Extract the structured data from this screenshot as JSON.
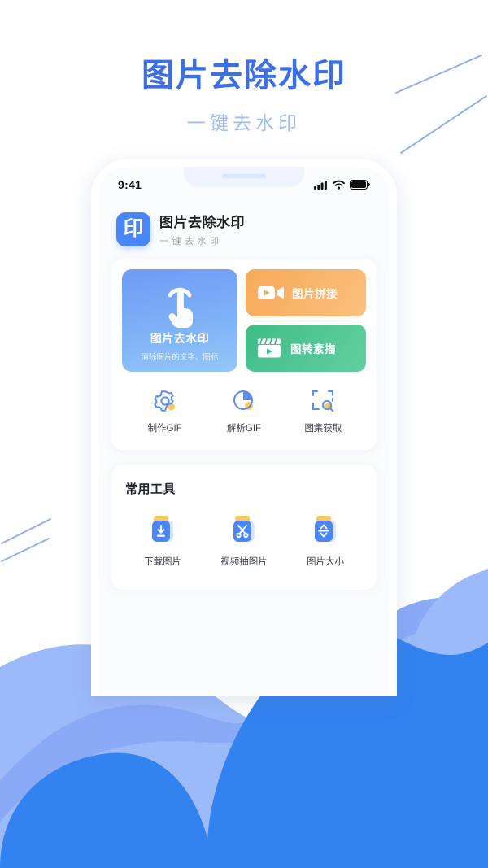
{
  "hero": {
    "title": "图片去除水印",
    "subtitle": "一键去水印",
    "title_color": "#3b6fe8",
    "subtitle_color": "#9fbcf2"
  },
  "phone": {
    "statusbar": {
      "time": "9:41",
      "signal_icon": "cellular-signal-icon",
      "wifi_icon": "wifi-icon",
      "battery_icon": "battery-full-icon"
    },
    "app_header": {
      "logo_glyph": "印",
      "logo_color": "#4a86f7",
      "app_name": "图片去除水印",
      "app_tagline": "一键去水印"
    },
    "features": {
      "main": {
        "title": "图片去水印",
        "subtitle": "清除图片的文字、图标",
        "icon": "tap-hand-icon",
        "color": "#7fb1f7"
      },
      "side": [
        {
          "label": "图片拼接",
          "icon": "video-camera-icon",
          "color": "#f7a959"
        },
        {
          "label": "图转素描",
          "icon": "clapperboard-icon",
          "color": "#3fbd89"
        }
      ],
      "tools": [
        {
          "label": "制作GIF",
          "icon": "gear-icon"
        },
        {
          "label": "解析GIF",
          "icon": "pie-chart-icon"
        },
        {
          "label": "图集获取",
          "icon": "crop-search-icon"
        }
      ]
    },
    "utilities": {
      "section_title": "常用工具",
      "items": [
        {
          "label": "下载图片",
          "icon": "download-jar-icon"
        },
        {
          "label": "视频抽图片",
          "icon": "scissors-jar-icon"
        },
        {
          "label": "图片大小",
          "icon": "resize-jar-icon"
        }
      ]
    }
  },
  "background": {
    "wave_light": "#8aaaf8",
    "wave_mid": "#9cbaf9",
    "wave_dark": "#3282f0",
    "line_color": "#8fb0ef"
  }
}
